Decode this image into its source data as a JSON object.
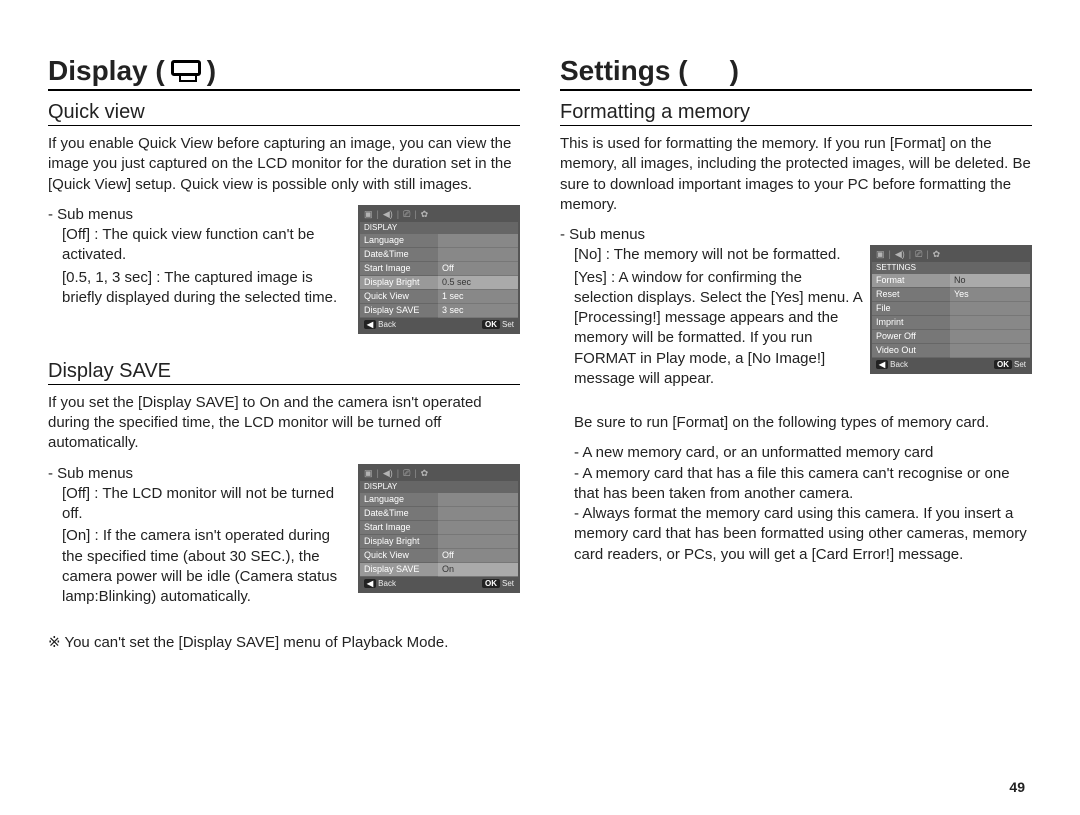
{
  "page_number": "49",
  "left": {
    "title": "Display (",
    "title_close": ")",
    "section1": {
      "heading": "Quick view",
      "para": "If you enable Quick View before capturing an image, you can view the image you just captured on the LCD monitor for the duration set in the [Quick View] setup. Quick view is possible only with still images.",
      "sub_label": "- Sub menus",
      "def1_term": "[Off]",
      "def1_desc": ": The quick view function can't be activated.",
      "def2_term": "[0.5, 1, 3 sec]",
      "def2_desc": ": The captured image is brieﬂy displayed during the selected time.",
      "ss": {
        "header": "DISPLAY",
        "rows": [
          {
            "l": "Language",
            "r": ""
          },
          {
            "l": "Date&Time",
            "r": ""
          },
          {
            "l": "Start Image",
            "r": "Off"
          },
          {
            "l": "Display Bright",
            "r": "0.5 sec",
            "hl": true
          },
          {
            "l": "Quick View",
            "r": "1 sec"
          },
          {
            "l": "Display SAVE",
            "r": "3 sec"
          }
        ],
        "back": "Back",
        "ok": "OK",
        "set": "Set"
      }
    },
    "section2": {
      "heading": "Display SAVE",
      "para": "If you set the [Display SAVE] to On and the camera isn't operated during the speciﬁed time, the LCD monitor will be turned off automatically.",
      "sub_label": "- Sub menus",
      "def1_term": "[Off]",
      "def1_desc": ": The LCD monitor will not be turned off.",
      "def2_term": "[On]",
      "def2_desc": ": If the camera isn't operated during the speciﬁed time (about 30 SEC.), the camera power will be idle (Camera status lamp:Blinking) automatically.",
      "note": "※ You can't set the [Display SAVE] menu of Playback Mode.",
      "ss": {
        "header": "DISPLAY",
        "rows": [
          {
            "l": "Language",
            "r": ""
          },
          {
            "l": "Date&Time",
            "r": ""
          },
          {
            "l": "Start Image",
            "r": ""
          },
          {
            "l": "Display Bright",
            "r": ""
          },
          {
            "l": "Quick View",
            "r": "Off"
          },
          {
            "l": "Display SAVE",
            "r": "On",
            "hl": true
          }
        ],
        "back": "Back",
        "ok": "OK",
        "set": "Set"
      }
    }
  },
  "right": {
    "title": "Settings (",
    "title_close": ")",
    "section1": {
      "heading": "Formatting a memory",
      "para": "This is used for formatting the memory. If you run [Format] on the memory, all images, including the protected images, will be deleted. Be sure to download important images to your PC before formatting the memory.",
      "sub_label": "- Sub menus",
      "def1_term": "[No]",
      "def1_desc": ": The memory will not be formatted.",
      "def2_term": "[Yes]",
      "def2_desc": ": A window for conﬁrming the selection displays. Select the [Yes] menu. A [Processing!] message appears and the memory will be formatted. If you run FORMAT in Play mode, a [No Image!] message will appear.",
      "ss": {
        "header": "SETTINGS",
        "rows": [
          {
            "l": "Format",
            "r": "No",
            "hl": true
          },
          {
            "l": "Reset",
            "r": "Yes"
          },
          {
            "l": "File",
            "r": ""
          },
          {
            "l": "Imprint",
            "r": ""
          },
          {
            "l": "Power Off",
            "r": ""
          },
          {
            "l": "Video Out",
            "r": ""
          }
        ],
        "back": "Back",
        "ok": "OK",
        "set": "Set"
      },
      "after_para": "Be sure to run [Format] on the following types of memory card.",
      "bullet1": "- A new memory card, or an unformatted memory card",
      "bullet2": "- A memory card that has a ﬁle this camera can't recognise or one that has been taken from another camera.",
      "bullet3": "- Always format the memory card using this camera. If you insert a memory card that has been formatted using other cameras, memory card readers, or PCs, you will get a [Card Error!] message."
    }
  }
}
